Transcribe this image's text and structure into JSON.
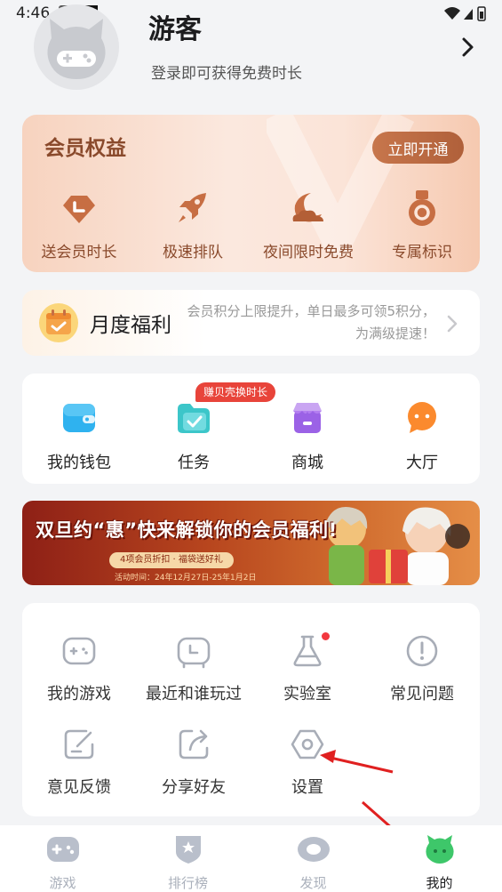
{
  "status": {
    "time": "4:46"
  },
  "user": {
    "name": "游客",
    "subtitle": "登录即可获得免费时长"
  },
  "vip": {
    "title": "会员权益",
    "button": "立即开通",
    "items": [
      {
        "label": "送会员时长",
        "icon": "clock-tag-icon"
      },
      {
        "label": "极速排队",
        "icon": "rocket-icon"
      },
      {
        "label": "夜间限时免费",
        "icon": "moon-cloud-icon"
      },
      {
        "label": "专属标识",
        "icon": "medal-icon"
      }
    ]
  },
  "monthly": {
    "title": "月度福利",
    "desc": "会员积分上限提升，单日最多可领5积分，为满级提速！"
  },
  "shortcuts": {
    "badge": "赚贝壳换时长",
    "items": [
      {
        "label": "我的钱包",
        "icon": "wallet-icon"
      },
      {
        "label": "任务",
        "icon": "task-folder-icon"
      },
      {
        "label": "商城",
        "icon": "store-icon"
      },
      {
        "label": "大厅",
        "icon": "chat-bubble-icon"
      }
    ]
  },
  "banner": {
    "title": "双旦约“惠”快来解锁你的会员福利!",
    "subtitle": "4项会员折扣 · 福袋送好礼",
    "date": "活动时间：24年12月27日-25年1月2日"
  },
  "grid": {
    "items": [
      {
        "label": "我的游戏",
        "icon": "gamepad-icon"
      },
      {
        "label": "最近和谁玩过",
        "icon": "recent-gamepad-icon"
      },
      {
        "label": "实验室",
        "icon": "flask-icon"
      },
      {
        "label": "常见问题",
        "icon": "exclamation-circle-icon"
      },
      {
        "label": "意见反馈",
        "icon": "feedback-edit-icon"
      },
      {
        "label": "分享好友",
        "icon": "share-icon"
      },
      {
        "label": "设置",
        "icon": "settings-hexagon-icon"
      }
    ]
  },
  "nav": {
    "items": [
      {
        "label": "游戏",
        "icon": "gamepad-nav-icon"
      },
      {
        "label": "排行榜",
        "icon": "rank-shield-icon"
      },
      {
        "label": "发现",
        "icon": "discover-eye-icon"
      },
      {
        "label": "我的",
        "icon": "mine-monster-icon"
      }
    ],
    "active": "我的"
  },
  "colors": {
    "accent": "#b0603a",
    "vip_text": "#8a4a2c",
    "active_nav": "#3ec76a",
    "red": "#e8443a"
  }
}
